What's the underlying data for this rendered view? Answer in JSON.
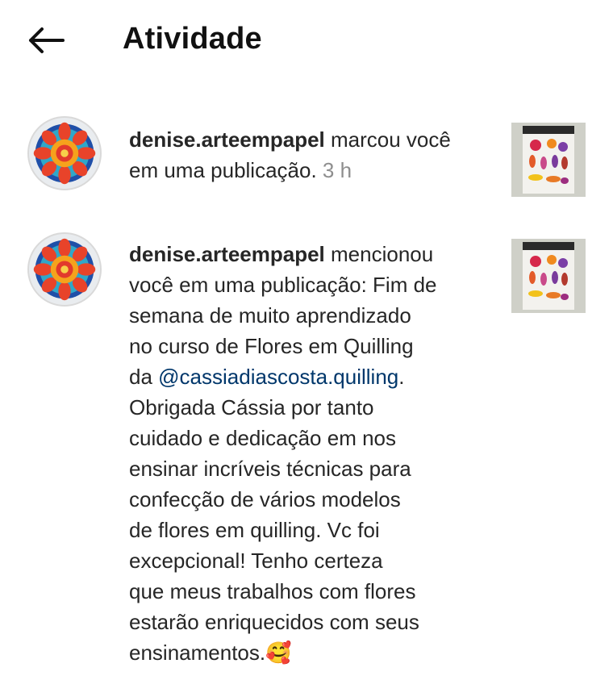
{
  "header": {
    "title": "Atividade",
    "back_icon": "arrow-left-icon"
  },
  "notifications": [
    {
      "username": "denise.arteempapel",
      "action": " marcou você em uma publicação.",
      "time": " 3 h"
    },
    {
      "username": "denise.arteempapel",
      "action_lines": [
        " mencionou",
        "você em uma publicação: Fim de",
        "semana de muito aprendizado",
        "no curso de Flores em Quilling"
      ],
      "prefix_mention": "da ",
      "mention": "@cassiadiascosta.quilling",
      "after_mention": ".",
      "rest_lines": [
        "Obrigada Cássia por tanto",
        "cuidado e dedicação em nos",
        "ensinar incríveis técnicas para",
        "confecção de vários modelos",
        "de flores em quilling. Vc foi",
        "excepcional! Tenho certeza",
        "que meus trabalhos com flores",
        "estarão enriquecidos com seus",
        "ensinamentos."
      ],
      "emoji": "🥰"
    }
  ],
  "colors": {
    "username": "#262626",
    "time": "#8e8e8e",
    "mention": "#00376b"
  }
}
